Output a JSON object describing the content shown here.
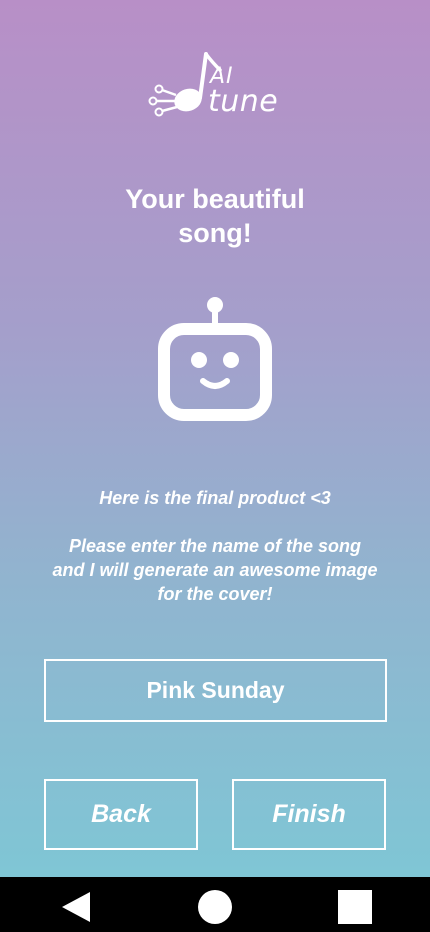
{
  "app": {
    "logo_text_top": "AI",
    "logo_text_bottom": "tune"
  },
  "header": {
    "title_line1": "Your beautiful",
    "title_line2": "song!"
  },
  "robot": {
    "icon": "robot-face-icon"
  },
  "message": {
    "line1": "Here is the final product <3",
    "line2": "Please enter the name of the song",
    "line3": "and I will generate an awesome image",
    "line4": "for the cover!"
  },
  "song_name": {
    "value": "Pink Sunday"
  },
  "actions": {
    "back_label": "Back",
    "finish_label": "Finish"
  },
  "navbar": {
    "back_icon": "nav-back-triangle-icon",
    "home_icon": "nav-home-circle-icon",
    "recent_icon": "nav-recent-square-icon"
  },
  "colors": {
    "gradient_top": "#b88fc7",
    "gradient_bottom": "#7fc6d5",
    "foreground": "#ffffff",
    "navbar": "#000000"
  }
}
